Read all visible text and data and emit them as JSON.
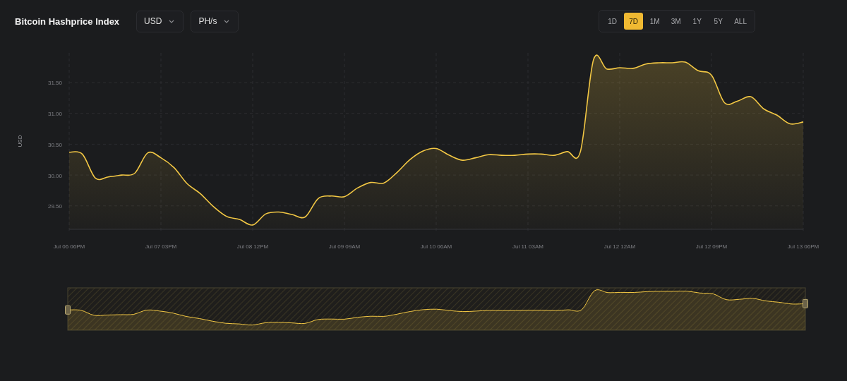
{
  "header": {
    "title": "Bitcoin Hashprice Index",
    "dropdowns": [
      {
        "value": "USD"
      },
      {
        "value": "PH/s"
      }
    ],
    "ranges": [
      {
        "label": "1D",
        "selected": false
      },
      {
        "label": "7D",
        "selected": true
      },
      {
        "label": "1M",
        "selected": false
      },
      {
        "label": "3M",
        "selected": false
      },
      {
        "label": "1Y",
        "selected": false
      },
      {
        "label": "5Y",
        "selected": false
      },
      {
        "label": "ALL",
        "selected": false
      }
    ]
  },
  "chart": {
    "chart_data": {
      "type": "area",
      "ylabel": "USD",
      "categories": [
        "Jul 06 06PM",
        null,
        null,
        null,
        null,
        null,
        null,
        "Jul 07 03PM",
        null,
        null,
        null,
        null,
        null,
        null,
        "Jul 08 12PM",
        null,
        null,
        null,
        null,
        null,
        null,
        "Jul 09 09AM",
        null,
        null,
        null,
        null,
        null,
        null,
        "Jul 10 06AM",
        null,
        null,
        null,
        null,
        null,
        null,
        "Jul 11 03AM",
        null,
        null,
        null,
        null,
        null,
        null,
        "Jul 12 12AM",
        null,
        null,
        null,
        null,
        null,
        null,
        "Jul 12 09PM",
        null,
        null,
        null,
        null,
        null,
        null,
        "Jul 13 06PM"
      ],
      "series": [
        {
          "color": "#f2c744",
          "values": [
            30.37,
            30.34,
            29.95,
            29.97,
            30.0,
            30.03,
            30.36,
            30.28,
            30.12,
            29.86,
            29.7,
            29.49,
            29.33,
            29.28,
            29.19,
            29.37,
            29.4,
            29.36,
            29.32,
            29.62,
            29.66,
            29.65,
            29.79,
            29.88,
            29.87,
            30.04,
            30.25,
            30.39,
            30.43,
            30.32,
            30.24,
            30.28,
            30.33,
            30.32,
            30.32,
            30.34,
            30.34,
            30.32,
            30.38,
            30.38,
            31.87,
            31.72,
            31.74,
            31.73,
            31.8,
            31.82,
            31.82,
            31.83,
            31.69,
            31.62,
            31.17,
            31.2,
            31.27,
            31.07,
            30.97,
            30.83,
            30.86
          ]
        }
      ],
      "ylim": [
        29.12,
        31.98
      ],
      "grid": true,
      "yticks": [
        {
          "value": 29.5,
          "label": "29.50"
        },
        {
          "value": 30,
          "label": "30.00"
        },
        {
          "value": 30.5,
          "label": "30.50"
        },
        {
          "value": 31,
          "label": "31.00"
        },
        {
          "value": 31.5,
          "label": "31.50"
        }
      ]
    }
  }
}
